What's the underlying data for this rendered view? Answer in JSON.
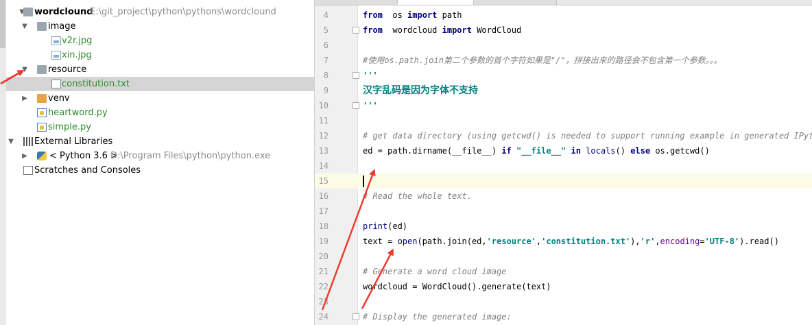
{
  "project_tree": {
    "root": {
      "name": "wordclound",
      "path": "E:\\git_project\\python\\pythons\\wordclound"
    },
    "image_folder": "image",
    "image_files": [
      "v2r.jpg",
      "xin.jpg"
    ],
    "resource_folder": "resource",
    "resource_file": "constitution.txt",
    "venv_folder": "venv",
    "py_files": [
      "heartword.py",
      "simple.py"
    ],
    "external_libraries": "External Libraries",
    "python_sdk": {
      "name": "< Python 3.6 >",
      "path": "D:\\Program Files\\python\\python.exe"
    },
    "scratches": "Scratches and Consoles"
  },
  "editor": {
    "current_line": 15,
    "lines": [
      {
        "n": "4",
        "t": [
          [
            "kw",
            "from"
          ],
          [
            "",
            "  os "
          ],
          [
            "kw",
            "import"
          ],
          [
            "",
            " path"
          ]
        ]
      },
      {
        "n": "5",
        "t": [
          [
            "kw",
            "from"
          ],
          [
            "",
            "",
            " "
          ],
          [
            "",
            " wordcloud "
          ],
          [
            "kw",
            "import"
          ],
          [
            "",
            " WordCloud"
          ]
        ]
      },
      {
        "n": "6",
        "t": []
      },
      {
        "n": "7",
        "t": [
          [
            "cmt",
            "#使用os.path.join第二个参数的首个字符如果是\"/\"，拼接出来的路径会不包含第一个参数。。。"
          ]
        ]
      },
      {
        "n": "8",
        "t": [
          [
            "str",
            "'''"
          ]
        ]
      },
      {
        "n": "9",
        "t": [
          [
            "big",
            "汉字乱码是因为字体不支持"
          ]
        ]
      },
      {
        "n": "10",
        "t": [
          [
            "str",
            "'''"
          ]
        ]
      },
      {
        "n": "11",
        "t": []
      },
      {
        "n": "12",
        "t": [
          [
            "cmt",
            "# get data directory (using getcwd() is needed to support running example in generated IPython"
          ]
        ]
      },
      {
        "n": "13",
        "t": [
          [
            "",
            "ed = path.dirname(__file__) "
          ],
          [
            "kw",
            "if"
          ],
          [
            "",
            " "
          ],
          [
            "str",
            "\"__file__\""
          ],
          [
            "",
            " "
          ],
          [
            "kw",
            "in"
          ],
          [
            "",
            " "
          ],
          [
            "bi",
            "locals"
          ],
          [
            "",
            "() "
          ],
          [
            "kw",
            "else"
          ],
          [
            "",
            " os.getcwd()"
          ]
        ]
      },
      {
        "n": "14",
        "t": []
      },
      {
        "n": "15",
        "t": []
      },
      {
        "n": "16",
        "t": [
          [
            "cmt",
            "# Read the whole text."
          ]
        ]
      },
      {
        "n": "17",
        "t": []
      },
      {
        "n": "18",
        "t": [
          [
            "bi",
            "print"
          ],
          [
            "",
            "(ed)"
          ]
        ]
      },
      {
        "n": "19",
        "t": [
          [
            "",
            "text = "
          ],
          [
            "bi",
            "open"
          ],
          [
            "",
            "(path.join(ed,"
          ],
          [
            "str",
            "'resource'"
          ],
          [
            "",
            ","
          ],
          [
            "str",
            "'constitution.txt'"
          ],
          [
            "",
            "),"
          ],
          [
            "str",
            "'r'"
          ],
          [
            "",
            ","
          ],
          [
            "kwarg",
            "encoding"
          ],
          [
            "",
            "="
          ],
          [
            "str",
            "'UTF-8'"
          ],
          [
            "",
            ").read()"
          ]
        ]
      },
      {
        "n": "20",
        "t": []
      },
      {
        "n": "21",
        "t": [
          [
            "cmt",
            "# Generate a word cloud image"
          ]
        ]
      },
      {
        "n": "22",
        "t": [
          [
            "",
            "wordcloud = WordCloud().generate(text)"
          ]
        ]
      },
      {
        "n": "23",
        "t": []
      },
      {
        "n": "24",
        "t": [
          [
            "cmt",
            "# Display the generated image:"
          ]
        ]
      }
    ]
  },
  "colors": {
    "annotation_arrow": "#ee3b2f",
    "selected_row": "#d5d5d5",
    "current_line": "#fcfbe6"
  }
}
